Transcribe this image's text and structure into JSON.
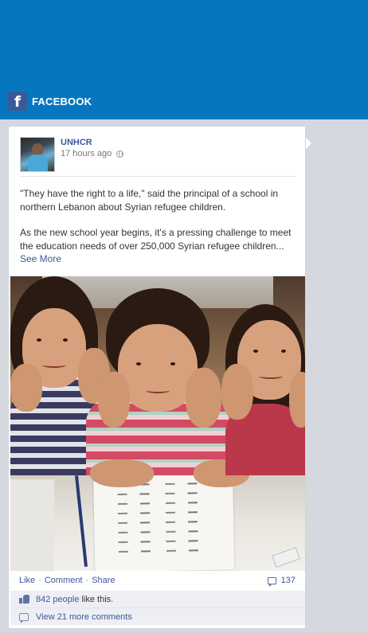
{
  "header": {
    "logo_letter": "f",
    "title": "FACEBOOK",
    "banner_color": "#0677bf"
  },
  "post": {
    "page_name": "UNHCR",
    "timestamp": "17 hours ago",
    "privacy_icon": "globe-icon",
    "paragraph1": "\"They have the right to a life,\" said the principal of a school in northern Lebanon about Syrian refugee children.",
    "paragraph2": "As the new school year begins, it's a pressing challenge to meet the education needs of over 250,000 Syrian refugee children...",
    "see_more": "See More",
    "photo_alt": "Three girls smiling with chins resting on hands at a school desk"
  },
  "actions": {
    "like": "Like",
    "comment": "Comment",
    "share": "Share",
    "separator": "·",
    "comment_count": "137"
  },
  "likes": {
    "count": "842 people",
    "suffix": "like this."
  },
  "comments": {
    "view_more": "View 21 more comments"
  }
}
